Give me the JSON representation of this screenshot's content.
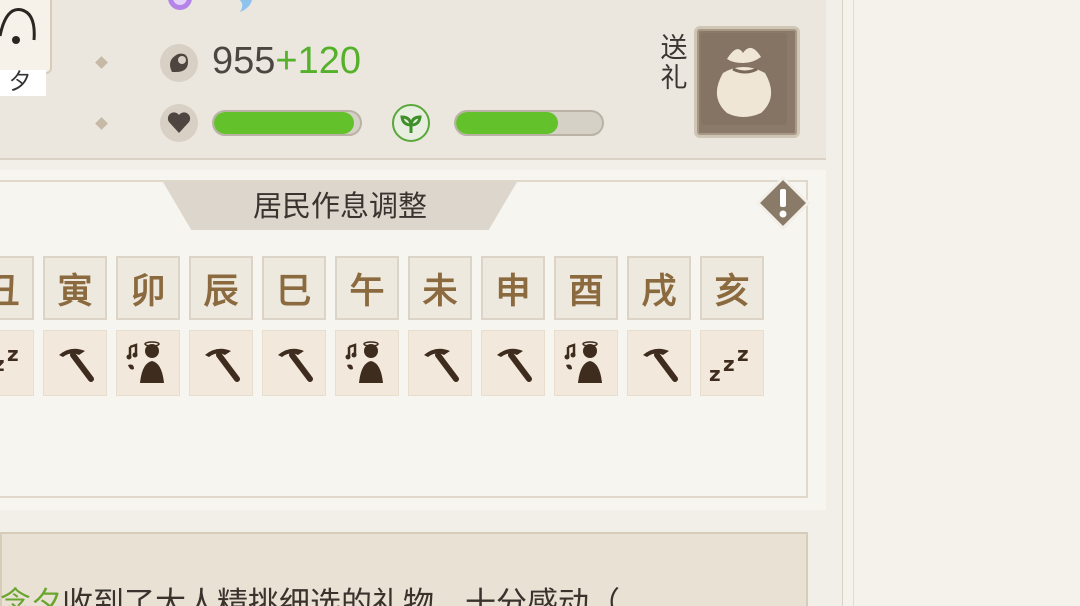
{
  "resident": {
    "name_fragment": "夕",
    "charm_base": "955",
    "charm_bonus": "+120",
    "health_level": 0.96,
    "mood_level": 0.7
  },
  "gift": {
    "label_line1": "送",
    "label_line2": "礼"
  },
  "schedule": {
    "title": "居民作息调整",
    "hours": [
      "丑",
      "寅",
      "卯",
      "辰",
      "巳",
      "午",
      "未",
      "申",
      "酉",
      "戌",
      "亥"
    ],
    "activities": [
      "sleep",
      "work",
      "leisure",
      "work",
      "work",
      "leisure",
      "work",
      "work",
      "leisure",
      "work",
      "sleep"
    ]
  },
  "message": {
    "name": "念夕",
    "text": "收到了大人精挑细选的礼物，十分感动（"
  },
  "colors": {
    "bar_fill": "#63c12c",
    "bonus_text": "#55b02a",
    "hour_text": "#8a6a3e",
    "activity_icon": "#3e2c1e"
  }
}
